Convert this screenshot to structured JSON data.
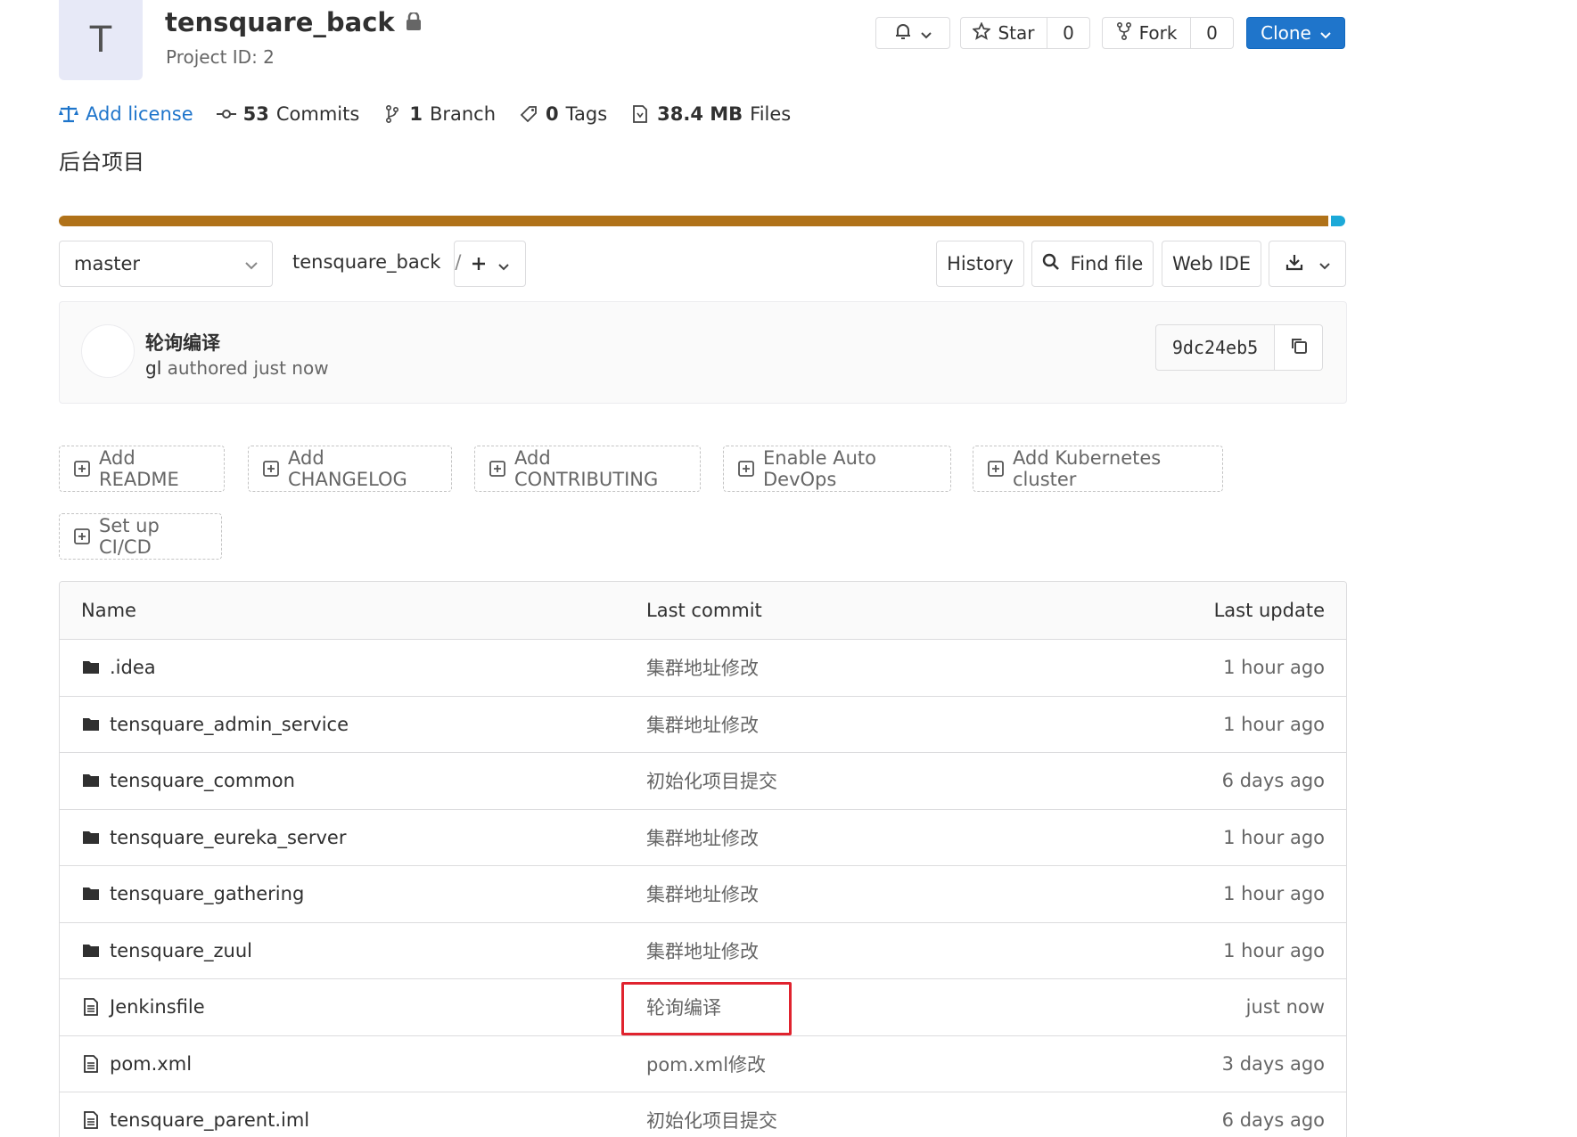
{
  "project": {
    "avatar_letter": "T",
    "name": "tensquare_back",
    "project_id": "Project ID: 2",
    "description": "后台项目"
  },
  "actions": {
    "star_label": "Star",
    "star_count": "0",
    "fork_label": "Fork",
    "fork_count": "0",
    "clone_label": "Clone",
    "accent": "#1f75cb"
  },
  "stats": {
    "license": "Add license",
    "commits_count": "53",
    "commits_label": "Commits",
    "branch_count": "1",
    "branch_label": "Branch",
    "tags_count": "0",
    "tags_label": "Tags",
    "files_size": "38.4 MB",
    "files_label": "Files"
  },
  "languages": [
    {
      "color": "#b07219",
      "percent": 98.7
    },
    {
      "color": "#1ca9d8",
      "percent": 1.3
    }
  ],
  "tree": {
    "branch": "master",
    "breadcrumb_root": "tensquare_back",
    "breadcrumb_sep": "/",
    "history_label": "History",
    "find_file_label": "Find file",
    "web_ide_label": "Web IDE"
  },
  "last_commit": {
    "title": "轮询编译",
    "author": "gl",
    "meta": "authored just now",
    "sha": "9dc24eb5"
  },
  "quick_actions": [
    "Add README",
    "Add CHANGELOG",
    "Add CONTRIBUTING",
    "Enable Auto DevOps",
    "Add Kubernetes cluster",
    "Set up CI/CD"
  ],
  "table": {
    "headers": {
      "name": "Name",
      "last_commit": "Last commit",
      "last_update": "Last update"
    },
    "rows": [
      {
        "type": "folder",
        "name": ".idea",
        "commit": "集群地址修改",
        "updated": "1 hour ago"
      },
      {
        "type": "folder",
        "name": "tensquare_admin_service",
        "commit": "集群地址修改",
        "updated": "1 hour ago"
      },
      {
        "type": "folder",
        "name": "tensquare_common",
        "commit": "初始化项目提交",
        "updated": "6 days ago"
      },
      {
        "type": "folder",
        "name": "tensquare_eureka_server",
        "commit": "集群地址修改",
        "updated": "1 hour ago"
      },
      {
        "type": "folder",
        "name": "tensquare_gathering",
        "commit": "集群地址修改",
        "updated": "1 hour ago"
      },
      {
        "type": "folder",
        "name": "tensquare_zuul",
        "commit": "集群地址修改",
        "updated": "1 hour ago"
      },
      {
        "type": "file",
        "name": "Jenkinsfile",
        "commit": "轮询编译",
        "updated": "just now"
      },
      {
        "type": "file",
        "name": "pom.xml",
        "commit": "pom.xml修改",
        "updated": "3 days ago"
      },
      {
        "type": "file",
        "name": "tensquare_parent.iml",
        "commit": "初始化项目提交",
        "updated": "6 days ago"
      }
    ]
  }
}
